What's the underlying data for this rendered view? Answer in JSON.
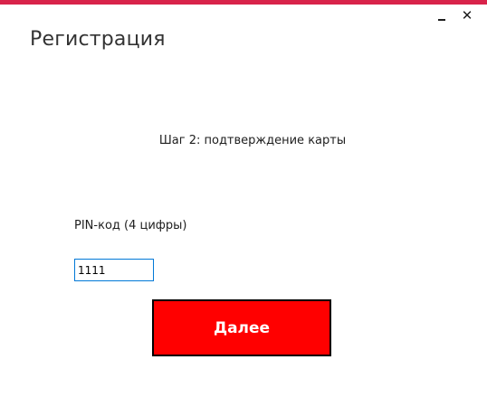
{
  "colors": {
    "accent_bar": "#d8234a",
    "next_button_bg": "#ff0000",
    "input_border": "#0078d7"
  },
  "window": {
    "minimize_label": "_",
    "close_label": "✕",
    "title": "Регистрация"
  },
  "form": {
    "step_text": "Шаг 2: подтверждение карты",
    "pin_label": "PIN-код (4 цифры)",
    "pin_value": "1111",
    "next_label": "Далее"
  },
  "icons": {
    "minimize": "minimize-icon",
    "close": "close-icon"
  }
}
